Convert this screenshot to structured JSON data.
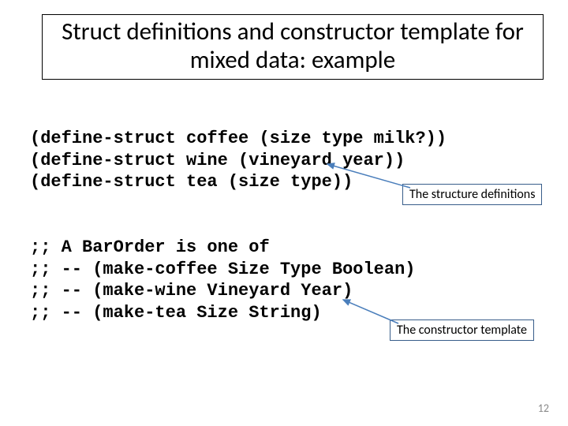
{
  "title": "Struct definitions and constructor template for mixed data: example",
  "code_block_1": "(define-struct coffee (size type milk?))\n(define-struct wine (vineyard year))\n(define-struct tea (size type))",
  "code_block_2": ";; A BarOrder is one of\n;; -- (make-coffee Size Type Boolean)\n;; -- (make-wine Vineyard Year)\n;; -- (make-tea Size String)",
  "callout_struct_defs": "The structure definitions",
  "callout_constructor": "The constructor template",
  "page_number": "12"
}
